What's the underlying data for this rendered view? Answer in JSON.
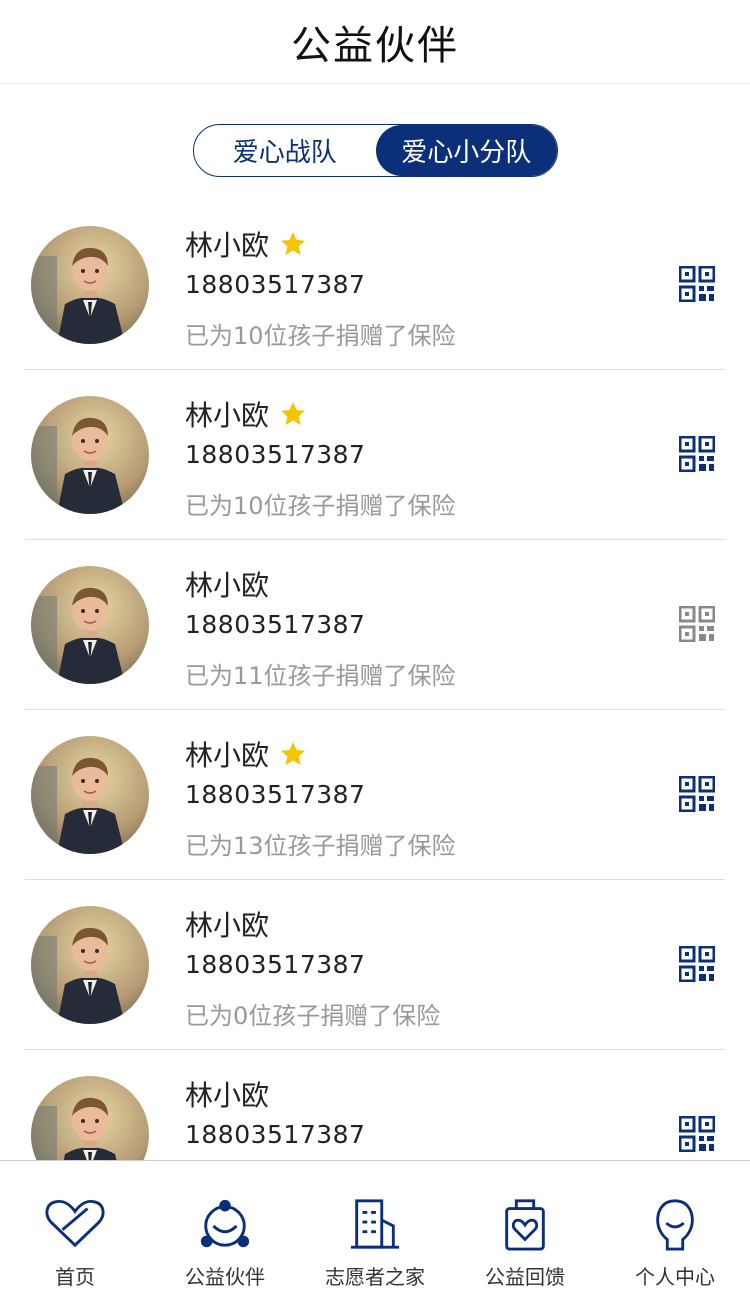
{
  "header": {
    "title": "公益伙伴"
  },
  "tabs": [
    {
      "label": "爱心战队",
      "active": false
    },
    {
      "label": "爱心小分队",
      "active": true
    }
  ],
  "colors": {
    "brand": "#0c2f7a",
    "star": "#f5c400",
    "qr_inactive": "#888888",
    "muted_text": "#999999"
  },
  "partners": [
    {
      "name": "林小欧",
      "phone": "18803517387",
      "desc": "已为10位孩子捐赠了保险",
      "starred": true,
      "qr_icon": "qr-code-icon",
      "qr_active": true
    },
    {
      "name": "林小欧",
      "phone": "18803517387",
      "desc": "已为10位孩子捐赠了保险",
      "starred": true,
      "qr_icon": "qr-code-icon",
      "qr_active": true
    },
    {
      "name": "林小欧",
      "phone": "18803517387",
      "desc": "已为11位孩子捐赠了保险",
      "starred": false,
      "qr_icon": "qr-code-icon",
      "qr_active": false
    },
    {
      "name": "林小欧",
      "phone": "18803517387",
      "desc": "已为13位孩子捐赠了保险",
      "starred": true,
      "qr_icon": "qr-code-icon",
      "qr_active": true
    },
    {
      "name": "林小欧",
      "phone": "18803517387",
      "desc": "已为0位孩子捐赠了保险",
      "starred": false,
      "qr_icon": "qr-code-icon",
      "qr_active": true
    },
    {
      "name": "林小欧",
      "phone": "18803517387",
      "desc": "",
      "starred": false,
      "qr_icon": "qr-code-icon",
      "qr_active": true
    }
  ],
  "bottom_nav": [
    {
      "label": "首页",
      "icon": "heart-icon"
    },
    {
      "label": "公益伙伴",
      "icon": "partners-icon"
    },
    {
      "label": "志愿者之家",
      "icon": "building-icon"
    },
    {
      "label": "公益回馈",
      "icon": "gift-bag-icon"
    },
    {
      "label": "个人中心",
      "icon": "user-icon"
    }
  ]
}
